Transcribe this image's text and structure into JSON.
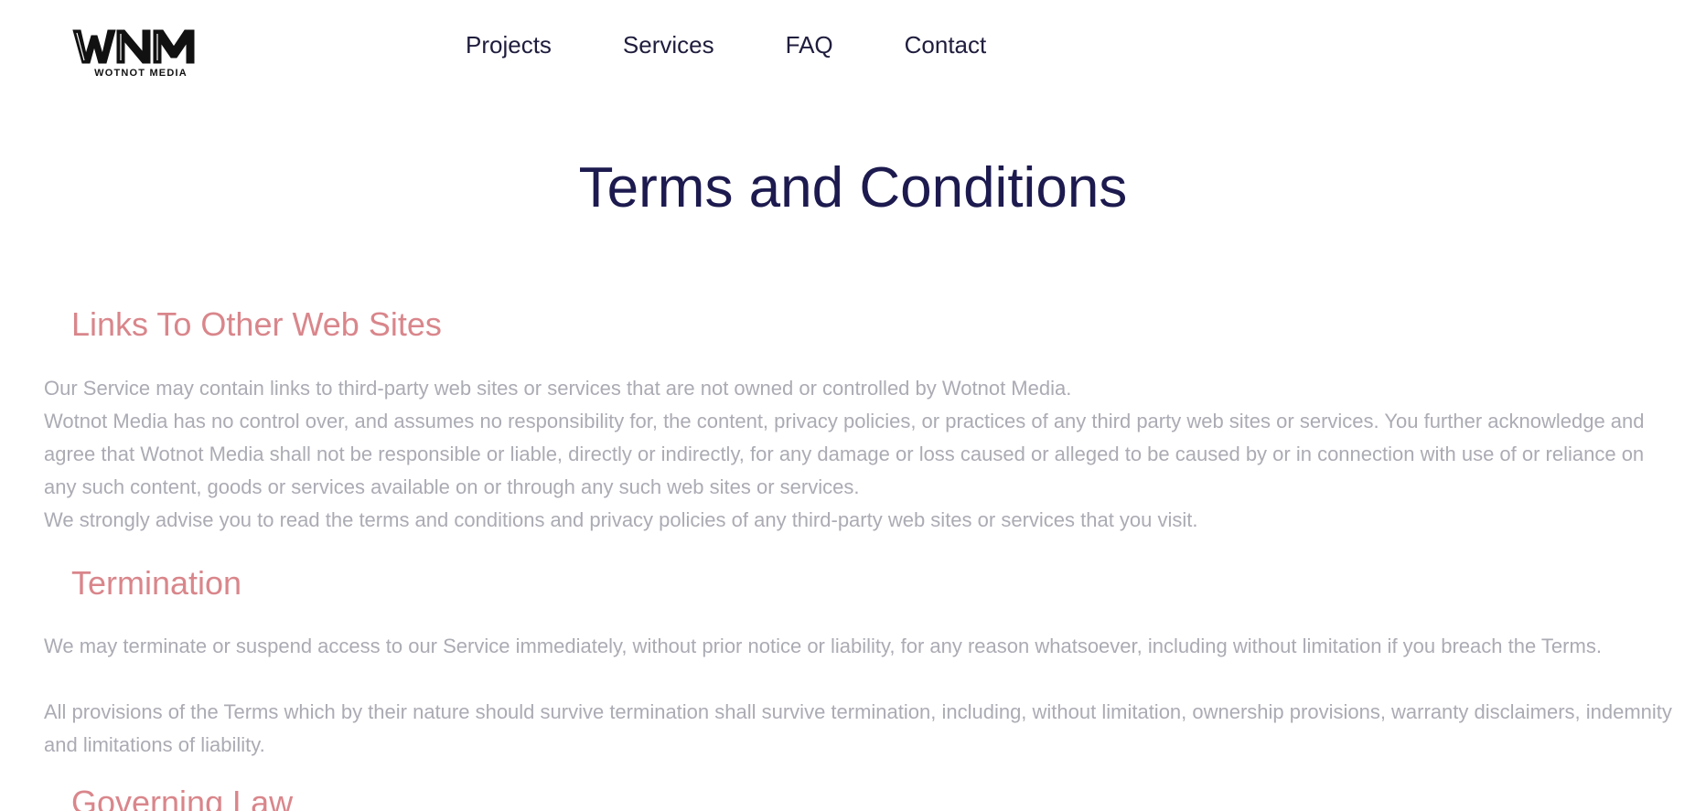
{
  "header": {
    "logo": {
      "mark": "WNM",
      "wordmark": "WOTNOT MEDIA"
    },
    "nav": [
      {
        "label": "Projects"
      },
      {
        "label": "Services"
      },
      {
        "label": "FAQ"
      },
      {
        "label": "Contact"
      }
    ]
  },
  "main": {
    "title": "Terms and Conditions",
    "sections": [
      {
        "heading": "Links To Other Web Sites",
        "paragraphs": [
          "Our Service may contain links to third-party web sites or services that are not owned or controlled by Wotnot Media.",
          "Wotnot Media has no control over, and assumes no responsibility for, the content, privacy policies, or practices of any third party web sites or services. You further acknowledge and agree that Wotnot Media shall not be responsible or liable, directly or indirectly, for any damage or loss caused or alleged to be caused by or in connection with use of or reliance on any such content, goods or services available on or through any such web sites or services.",
          "We strongly advise you to read the terms and conditions and privacy policies of any third-party web sites or services that you visit."
        ]
      },
      {
        "heading": "Termination",
        "paragraphs": [
          "We may terminate or suspend access to our Service immediately, without prior notice or liability, for any reason whatsoever, including without limitation if you breach the Terms.",
          "All provisions of the Terms which by their nature should survive termination shall survive termination, including, without limitation, ownership provisions, warranty disclaimers, indemnity and limitations of liability."
        ]
      },
      {
        "heading": "Governing Law"
      }
    ]
  },
  "colors": {
    "nav_text": "#1f1d3d",
    "title": "#1c1a4e",
    "heading": "#d9868b",
    "body_text": "#ababb4",
    "background": "#ffffff"
  }
}
